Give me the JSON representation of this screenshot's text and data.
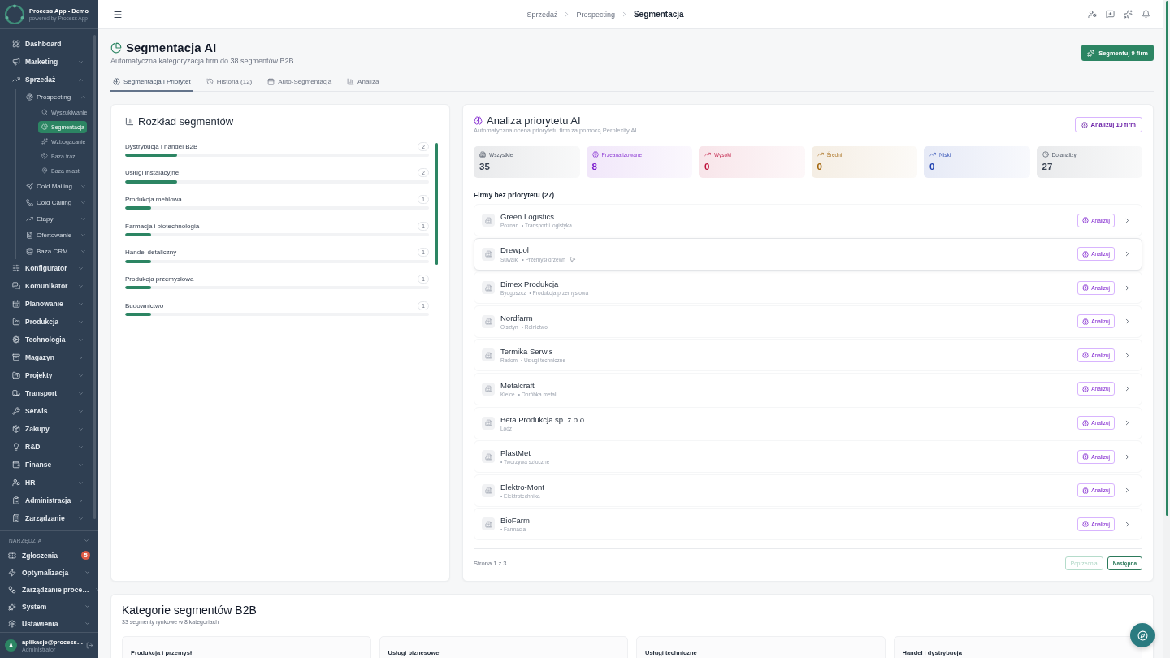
{
  "sidebar": {
    "brand": {
      "title": "Process App - Demo",
      "subtitle": "powered by Process App"
    },
    "items": [
      {
        "label": "Dashboard",
        "selected": false
      },
      {
        "label": "Marketing",
        "expanded": false
      },
      {
        "label": "Sprzedaż",
        "expanded": true,
        "children": [
          {
            "label": "Prospecting",
            "expanded": true,
            "children": [
              {
                "label": "Wyszukiwanie",
                "selected": false
              },
              {
                "label": "Segmentacja",
                "selected": true
              },
              {
                "label": "Wzbogacanie",
                "selected": false
              },
              {
                "label": "Baza fraz",
                "selected": false
              },
              {
                "label": "Baza miast",
                "selected": false
              }
            ]
          },
          {
            "label": "Cold Mailing",
            "expanded": false
          },
          {
            "label": "Cold Calling",
            "expanded": false
          },
          {
            "label": "Etapy",
            "expanded": false
          },
          {
            "label": "Ofertowanie",
            "expanded": false
          },
          {
            "label": "Baza CRM",
            "expanded": false
          }
        ]
      },
      {
        "label": "Konfigurator",
        "expanded": false
      },
      {
        "label": "Komunikator",
        "expanded": false
      },
      {
        "label": "Planowanie",
        "expanded": false
      },
      {
        "label": "Produkcja",
        "expanded": false
      },
      {
        "label": "Technologia",
        "expanded": false
      },
      {
        "label": "Magazyn",
        "expanded": false
      },
      {
        "label": "Projekty",
        "expanded": false
      },
      {
        "label": "Transport",
        "expanded": false
      },
      {
        "label": "Serwis",
        "expanded": false
      },
      {
        "label": "Zakupy",
        "expanded": false
      },
      {
        "label": "R&D",
        "expanded": false
      },
      {
        "label": "Finanse",
        "expanded": false
      },
      {
        "label": "HR",
        "expanded": false
      },
      {
        "label": "Administracja",
        "expanded": false
      },
      {
        "label": "Zarządzanie",
        "expanded": false
      }
    ],
    "tools": {
      "title": "NARZĘDZIA",
      "items": [
        {
          "label": "Zgłoszenia",
          "badge": "5"
        },
        {
          "label": "Optymalizacja",
          "expanded": false
        },
        {
          "label": "Zarządzanie proce…",
          "expanded": false
        },
        {
          "label": "System",
          "expanded": false
        },
        {
          "label": "Ustawienia",
          "expanded": false
        }
      ]
    },
    "user": {
      "initial": "A",
      "name": "aplikacje@process…",
      "role": "Administrator"
    }
  },
  "header": {
    "breadcrumb": [
      {
        "label": "Sprzedaż",
        "current": false
      },
      {
        "label": "Prospecting",
        "current": false
      },
      {
        "label": "Segmentacja",
        "current": true
      }
    ]
  },
  "page": {
    "title": "Segmentacja AI",
    "subtitle": "Automatyczna kategoryzacja firm do 38 segmentów B2B",
    "action": "Segmentuj 9 firm"
  },
  "tabs": [
    {
      "label": "Segmentacja i Priorytet",
      "selected": true
    },
    {
      "label": "Historia (12)",
      "selected": false
    },
    {
      "label": "Auto-Segmentacja",
      "selected": false
    },
    {
      "label": "Analiza",
      "selected": false
    }
  ],
  "segments": {
    "title": "Rozkład segmentów",
    "items": [
      {
        "name": "Dystrybucja i handel B2B",
        "count": "2",
        "level": 0.17
      },
      {
        "name": "Usługi instalacyjne",
        "count": "2",
        "level": 0.17
      },
      {
        "name": "Produkcja meblowa",
        "count": "1",
        "level": 0.085
      },
      {
        "name": "Farmacja i biotechnologia",
        "count": "1",
        "level": 0.085
      },
      {
        "name": "Handel detaliczny",
        "count": "1",
        "level": 0.085
      },
      {
        "name": "Produkcja przemysłowa",
        "count": "1",
        "level": 0.085
      },
      {
        "name": "Budownictwo",
        "count": "1",
        "level": 0.085
      }
    ]
  },
  "priority": {
    "title": "Analiza priorytetu AI",
    "subtitle": "Automatyczna ocena priorytetu firm za pomocą Perplexity AI",
    "action": "Analizuj 10 firm",
    "stats": [
      {
        "label": "Wszystkie",
        "value": "35",
        "color": "#374151"
      },
      {
        "label": "Przeanalizowane",
        "value": "8",
        "color": "#7e22ce"
      },
      {
        "label": "Wysoki",
        "value": "0",
        "color": "#be123c"
      },
      {
        "label": "Średni",
        "value": "0",
        "color": "#a16207"
      },
      {
        "label": "Niski",
        "value": "0",
        "color": "#1e40af"
      },
      {
        "label": "Do analizy",
        "value": "27",
        "color": "#374151"
      }
    ],
    "list_title": "Firmy bez priorytetu (27)",
    "companies": [
      {
        "name": "Green Logistics",
        "city": "Poznan",
        "category": "• Transport i logistyka",
        "hovered": false,
        "action": "Analizuj"
      },
      {
        "name": "Drewpol",
        "city": "Suwalki",
        "category": "• Przemysł drzewn",
        "hovered": true,
        "action": "Analizuj"
      },
      {
        "name": "Bimex Produkcja",
        "city": "Bydgoszcz",
        "category": "• Produkcja przemysłowa",
        "hovered": false,
        "action": "Analizuj"
      },
      {
        "name": "Nordfarm",
        "city": "Olsztyn",
        "category": "• Rolnictwo",
        "hovered": false,
        "action": "Analizuj"
      },
      {
        "name": "Termika Serwis",
        "city": "Radom",
        "category": "• Usługi techniczne",
        "hovered": false,
        "action": "Analizuj"
      },
      {
        "name": "Metalcraft",
        "city": "Kielce",
        "category": "• Obróbka metali",
        "hovered": false,
        "action": "Analizuj"
      },
      {
        "name": "Beta Produkcja sp. z o.o.",
        "city": "Lodz",
        "hovered": false,
        "action": "Analizuj"
      },
      {
        "name": "PlastMet",
        "category": "• Tworzywa sztuczne",
        "hovered": false,
        "action": "Analizuj"
      },
      {
        "name": "Elektro-Mont",
        "category": "• Elektrotechnika",
        "hovered": false,
        "action": "Analizuj"
      },
      {
        "name": "BioFarm",
        "category": "• Farmacja",
        "hovered": false,
        "action": "Analizuj"
      }
    ],
    "pagination": {
      "label": "Strona 1 z 3",
      "previous": {
        "label": "Poprzednia",
        "disabled": true
      },
      "next": {
        "label": "Następna",
        "disabled": false
      }
    }
  },
  "categories": {
    "title": "Kategorie segmentów B2B",
    "subtitle": "33 segmenty rynkowe w 8 kategoriach",
    "columns": [
      "Produkcja i przemysł",
      "Usługi biznesowe",
      "Usługi techniczne",
      "Handel i dystrybucja"
    ]
  }
}
